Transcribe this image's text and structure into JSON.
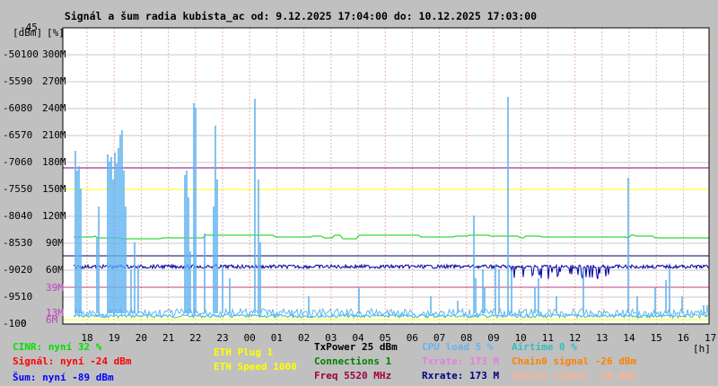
{
  "title": "Signál a šum radia kubista_ac od: 9.12.2025 17:04:00 do: 10.12.2025 17:03:00",
  "units": {
    "left": "[dBm]",
    "right": "[%]",
    "time": "[h]"
  },
  "colors": {
    "bg": "#c0c0c0",
    "plot": "#ffffff",
    "grid": "#c8c8c8",
    "vgrid": "#e6b4b4",
    "signal": "#64b4f0",
    "noise": "#0000a0",
    "cinr": "#00d000",
    "chain": "#30c0c0",
    "purple": "#800080",
    "yellow": "#ffff00",
    "mag": "#c04080",
    "navy": "#000060"
  },
  "legend": [
    {
      "text": "CINR: nyní 32 %",
      "color": "#00e000"
    },
    {
      "text": "Signál: nyní -24 dBm",
      "color": "#ff0000"
    },
    {
      "text": "Šum: nyní -89 dBm",
      "color": "#0000ff"
    },
    {
      "text": "ETH Plug 1",
      "color": "#ffff00"
    },
    {
      "text": "ETH Speed 1000",
      "color": "#ffff00"
    },
    {
      "text": "TxPower 25 dBm",
      "color": "#000000"
    },
    {
      "text": "Connections 1",
      "color": "#008000"
    },
    {
      "text": "Freq 5520 MHz",
      "color": "#a00040"
    },
    {
      "text": "CPU load 5 %",
      "color": "#64b4f0"
    },
    {
      "text": "Txrate: 173 M",
      "color": "#e080e0"
    },
    {
      "text": "Rxrate: 173 M",
      "color": "#000080"
    },
    {
      "text": "Airtime 0 %",
      "color": "#30c0c0"
    },
    {
      "text": "Chain0 signal -26 dBm",
      "color": "#ff8000"
    },
    {
      "text": "Chain1 signal -29 dBm",
      "color": "#ffb090"
    }
  ],
  "chart_data": {
    "type": "line",
    "title": "Signál a šum radia kubista_ac od: 9.12.2025 17:04:00 do: 10.12.2025 17:03:00",
    "xlabel": "[h]",
    "ylabel": "[dBm] [%]",
    "x_ticks": [
      "18",
      "19",
      "20",
      "21",
      "22",
      "23",
      "00",
      "01",
      "02",
      "03",
      "04",
      "05",
      "06",
      "07",
      "08",
      "09",
      "10",
      "11",
      "12",
      "13",
      "14",
      "15",
      "16",
      "17"
    ],
    "y_ticks_dbm": [
      -45,
      -50,
      -55,
      -60,
      -65,
      -70,
      -75,
      -80,
      -85,
      -90,
      -95,
      -100
    ],
    "y_ticks_pct": [
      100,
      90,
      80,
      70,
      60,
      50,
      40,
      30,
      20,
      10,
      0
    ],
    "y_ticks_rate": [
      "300M",
      "270M",
      "240M",
      "210M",
      "180M",
      "150M",
      "120M",
      "90M",
      "60M",
      "39M",
      "13M",
      "6M"
    ],
    "ylim": [
      -100,
      -45
    ],
    "reference_lines": [
      {
        "name": "Txrate",
        "value": 173,
        "unit": "M",
        "color": "#800080"
      },
      {
        "name": "ETH",
        "value": 150,
        "unit": "M",
        "color": "#ffff00"
      },
      {
        "name": "Connections",
        "value": 30,
        "unit": "%",
        "color": "#00c000"
      },
      {
        "name": "Noise",
        "value": -89,
        "unit": "dBm",
        "color": "#000060"
      },
      {
        "name": "Freq",
        "value": 39,
        "unit": "M",
        "color": "#c04080"
      }
    ],
    "series": [
      {
        "name": "CINR",
        "color": "#00d000",
        "values": [
          30,
          32,
          31,
          32,
          30,
          31,
          32,
          30,
          31,
          32,
          30,
          31,
          32,
          30,
          31,
          32,
          30,
          31,
          32,
          31,
          30,
          32,
          31,
          32
        ]
      },
      {
        "name": "Šum",
        "color": "#0000a0",
        "values": [
          -90,
          -90,
          -90,
          -90,
          -90,
          -90,
          -90,
          -90,
          -90,
          -90,
          -90,
          -90,
          -90,
          -90,
          -90,
          -90,
          -91,
          -91,
          -91,
          -91,
          -90,
          -90,
          -90,
          -90
        ]
      },
      {
        "name": "Signál",
        "color": "#64b4f0",
        "values": [
          -70,
          -73,
          -72,
          -97,
          -80,
          -63,
          -97,
          -98,
          -99,
          -99,
          -98,
          -98,
          -99,
          -98,
          -83,
          -57,
          -98,
          -99,
          -99,
          -98,
          -77,
          -93,
          -95,
          -97
        ]
      }
    ]
  }
}
